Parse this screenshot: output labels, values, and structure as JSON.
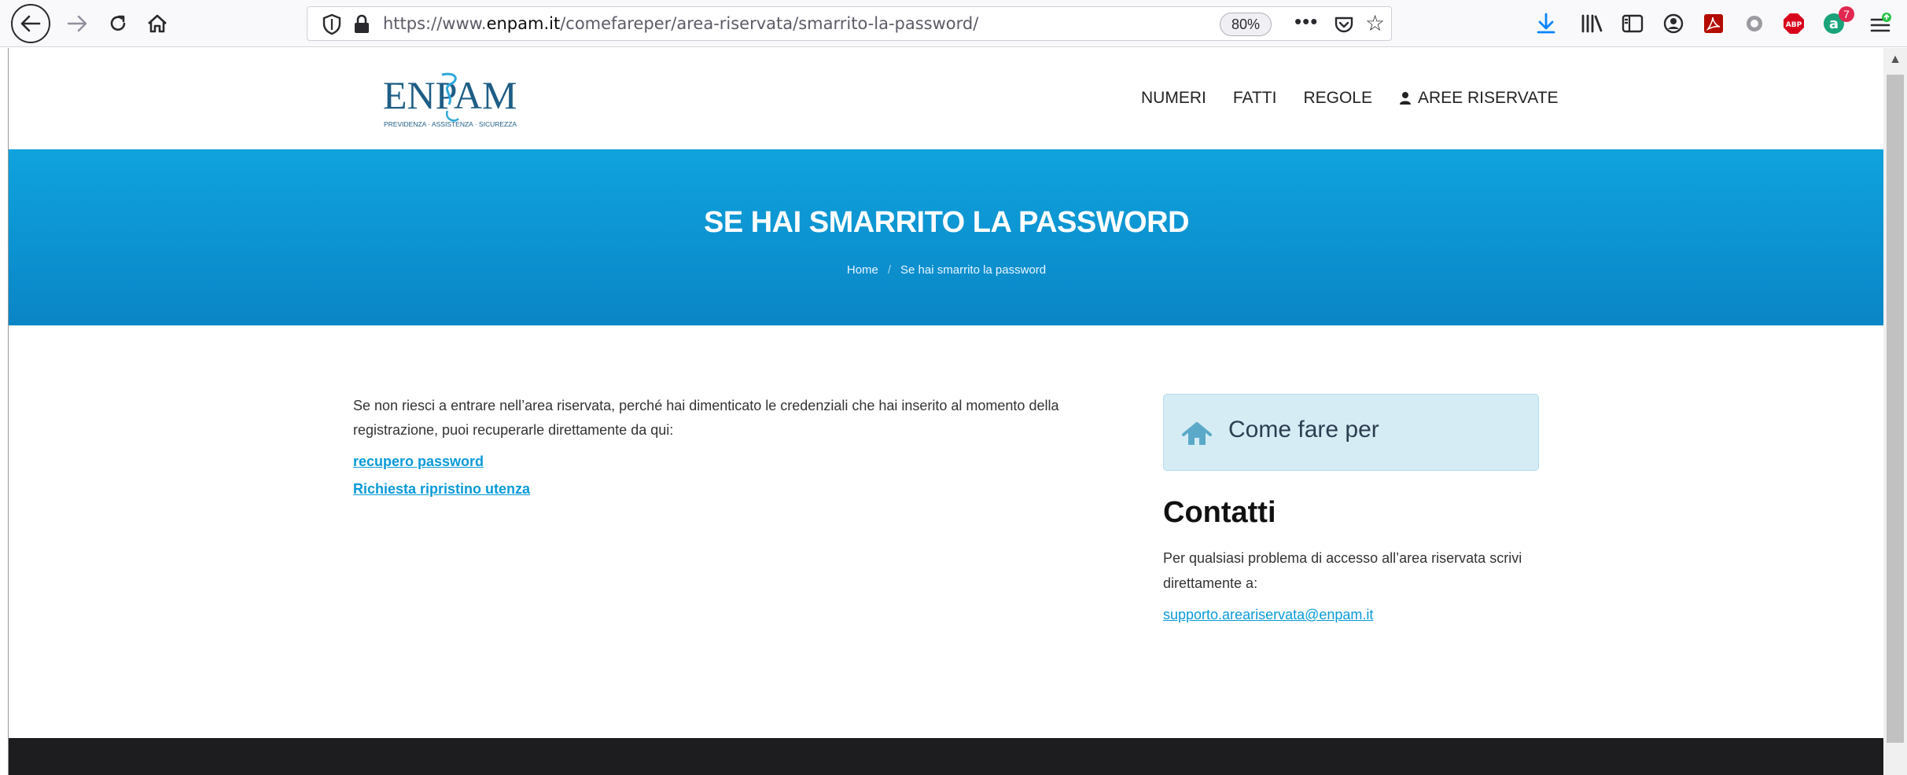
{
  "browser": {
    "url_prefix": "https://www.",
    "url_domain": "enpam.it",
    "url_path": "/comefareper/area-riservata/smarrito-la-password/",
    "zoom": "80%",
    "more_label": "•••",
    "extension_badge": "7",
    "icons": [
      "back-icon",
      "forward-icon",
      "reload-icon",
      "home-icon",
      "shield-icon",
      "lock-icon",
      "pocket-icon",
      "star-icon",
      "download-icon",
      "library-icon",
      "sidebar-icon",
      "account-icon",
      "pdf-icon",
      "circle-extension-icon",
      "adblock-icon",
      "a-extension-icon",
      "menu-icon"
    ]
  },
  "site": {
    "logo_text": "ENPAM",
    "logo_tagline": "PREVIDENZA · ASSISTENZA · SICUREZZA",
    "nav": [
      "NUMERI",
      "FATTI",
      "REGOLE",
      "AREE RISERVATE"
    ]
  },
  "hero": {
    "title": "SE HAI SMARRITO LA PASSWORD",
    "breadcrumb": [
      "Home",
      "Se hai smarrito la password"
    ],
    "breadcrumb_sep": "/"
  },
  "main": {
    "intro": "Se non riesci a entrare nell’area riservata, perché hai dimenticato le credenziali che hai inserito al momento della registrazione, puoi recuperarle direttamente da qui:",
    "links": [
      "recupero password",
      "Richiesta ripristino utenza"
    ]
  },
  "sidebar": {
    "howto_label": "Come fare per",
    "contacts_title": "Contatti",
    "contacts_text": "Per qualsiasi problema di accesso all’area riservata scrivi direttamente a:",
    "contacts_email": "supporto.areariservata@enpam.it"
  },
  "colors": {
    "hero_top": "#0fa3dd",
    "hero_bottom": "#0a85c6",
    "link": "#0a9ad8",
    "footer": "#1d1d20"
  }
}
